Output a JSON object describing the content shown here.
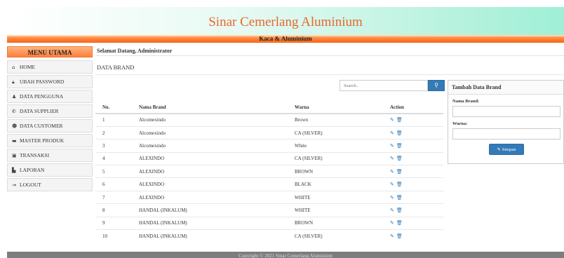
{
  "header": {
    "title": "Sinar Cemerlang Aluminium",
    "subtitle": "Kaca & Aluminium"
  },
  "sidebar": {
    "heading": "MENU UTAMA",
    "items": [
      {
        "label": "HOME",
        "icon": "home-icon",
        "glyph": "⌂"
      },
      {
        "label": "UBAH PASSWORD",
        "icon": "lock-icon",
        "glyph": "🔒︎"
      },
      {
        "label": "DATA PENGGUNA",
        "icon": "user-icon",
        "glyph": "♟"
      },
      {
        "label": "DATA SUPPLIER",
        "icon": "phone-icon",
        "glyph": "✆"
      },
      {
        "label": "DATA CUSTOMER",
        "icon": "users-icon",
        "glyph": "☻"
      },
      {
        "label": "MASTER PRODUK",
        "icon": "folder-icon",
        "glyph": "▬"
      },
      {
        "label": "TRANSAKSI",
        "icon": "transaction-icon",
        "glyph": "▣"
      },
      {
        "label": "LAPORAN",
        "icon": "file-icon",
        "glyph": "▙"
      },
      {
        "label": "LOGOUT",
        "icon": "logout-icon",
        "glyph": "⇥"
      }
    ]
  },
  "main": {
    "welcome": "Selamat Datang, Administrator",
    "page_title": "DATA BRAND",
    "search": {
      "placeholder": "Search..",
      "icon": "search-icon",
      "glyph": "⚲"
    }
  },
  "table": {
    "headers": [
      "No.",
      "Nama Brand",
      "Warna",
      "Action"
    ],
    "rows": [
      {
        "no": "1",
        "nama": "Alcomexindo",
        "warna": "Brown"
      },
      {
        "no": "2",
        "nama": "Alcomexindo",
        "warna": "CA (SILVER)"
      },
      {
        "no": "3",
        "nama": "Alcomexindo",
        "warna": "White"
      },
      {
        "no": "4",
        "nama": "ALEXINDO",
        "warna": "CA (SILVER)"
      },
      {
        "no": "5",
        "nama": "ALEXINDO",
        "warna": "BROWN"
      },
      {
        "no": "6",
        "nama": "ALEXINDO",
        "warna": "BLACK"
      },
      {
        "no": "7",
        "nama": "ALEXINDO",
        "warna": "WHITE"
      },
      {
        "no": "8",
        "nama": "HANDAL (INKALUM)",
        "warna": "WHITE"
      },
      {
        "no": "9",
        "nama": "HANDAL (INKALUM)",
        "warna": "BROWN"
      },
      {
        "no": "10",
        "nama": "HANDAL (INKALUM)",
        "warna": "CA (SILVER)"
      }
    ],
    "edit_glyph": "✎",
    "delete_glyph": "🗑︎"
  },
  "add_panel": {
    "title": "Tambah Data Brand",
    "nama_label": "Nama Brand:",
    "warna_label": "Warna:",
    "save_label": "Simpan",
    "save_glyph": "✎"
  },
  "footer": {
    "text": "Copyright © 2021 Sinar Cemerlang Aluminium"
  },
  "colors": {
    "accent": "#337ab7",
    "brand_orange": "#ff7e3a",
    "title_color": "#e8672c",
    "header_mint": "#9fefd6"
  }
}
